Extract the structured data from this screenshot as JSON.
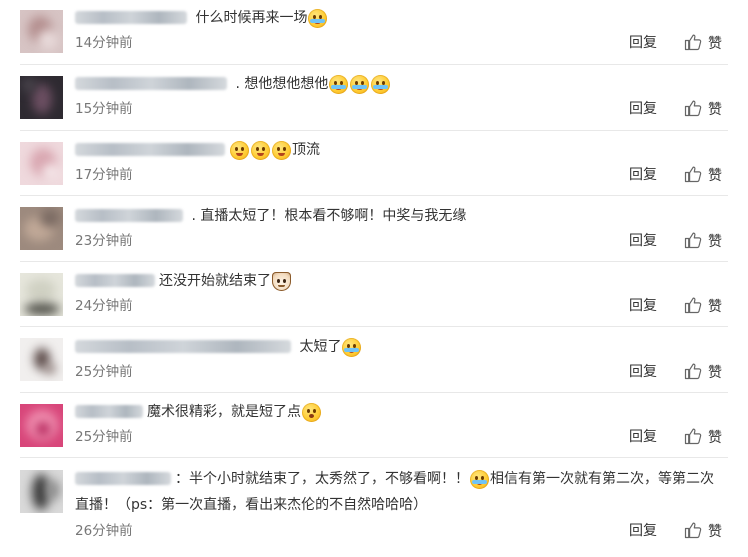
{
  "comments": [
    {
      "segments": [
        {
          "type": "text",
          "value": "什么时候再来一场"
        },
        {
          "type": "emoji",
          "icon": "crying-face-icon"
        }
      ],
      "time": "14分钟前",
      "reply_label": "回复",
      "like_label": "赞"
    },
    {
      "segments": [
        {
          "type": "text",
          "value": ". 想他想他想他"
        },
        {
          "type": "emoji",
          "icon": "crying-face-icon"
        },
        {
          "type": "emoji",
          "icon": "crying-face-icon"
        },
        {
          "type": "emoji",
          "icon": "crying-face-icon"
        }
      ],
      "time": "15分钟前",
      "reply_label": "回复",
      "like_label": "赞"
    },
    {
      "segments": [
        {
          "type": "emoji",
          "icon": "blushing-face-icon"
        },
        {
          "type": "emoji",
          "icon": "blushing-face-icon"
        },
        {
          "type": "emoji",
          "icon": "blushing-face-icon"
        },
        {
          "type": "text",
          "value": "顶流"
        }
      ],
      "time": "17分钟前",
      "reply_label": "回复",
      "like_label": "赞"
    },
    {
      "segments": [
        {
          "type": "text",
          "value": ". 直播太短了！根本看不够啊！中奖与我无缘"
        }
      ],
      "time": "23分钟前",
      "reply_label": "回复",
      "like_label": "赞"
    },
    {
      "segments": [
        {
          "type": "text",
          "value": "还没开始就结束了"
        },
        {
          "type": "emoji",
          "icon": "cat-face-icon"
        }
      ],
      "time": "24分钟前",
      "reply_label": "回复",
      "like_label": "赞"
    },
    {
      "segments": [
        {
          "type": "text",
          "value": "太短了"
        },
        {
          "type": "emoji",
          "icon": "crying-laughing-face-icon"
        }
      ],
      "time": "25分钟前",
      "reply_label": "回复",
      "like_label": "赞"
    },
    {
      "segments": [
        {
          "type": "text",
          "value": "魔术很精彩，就是短了点"
        },
        {
          "type": "emoji",
          "icon": "surprised-face-icon"
        }
      ],
      "time": "25分钟前",
      "reply_label": "回复",
      "like_label": "赞"
    },
    {
      "segments": [
        {
          "type": "text",
          "value": "：半个小时就结束了，太秀然了，不够看啊！！"
        },
        {
          "type": "emoji",
          "icon": "crying-laughing-face-icon"
        },
        {
          "type": "text",
          "value": "相信有第一次就有第二次，等第二次直播！（ps：第一次直播，看出来杰伦的不自然哈哈哈）"
        }
      ],
      "time": "26分钟前",
      "reply_label": "回复",
      "like_label": "赞"
    }
  ]
}
